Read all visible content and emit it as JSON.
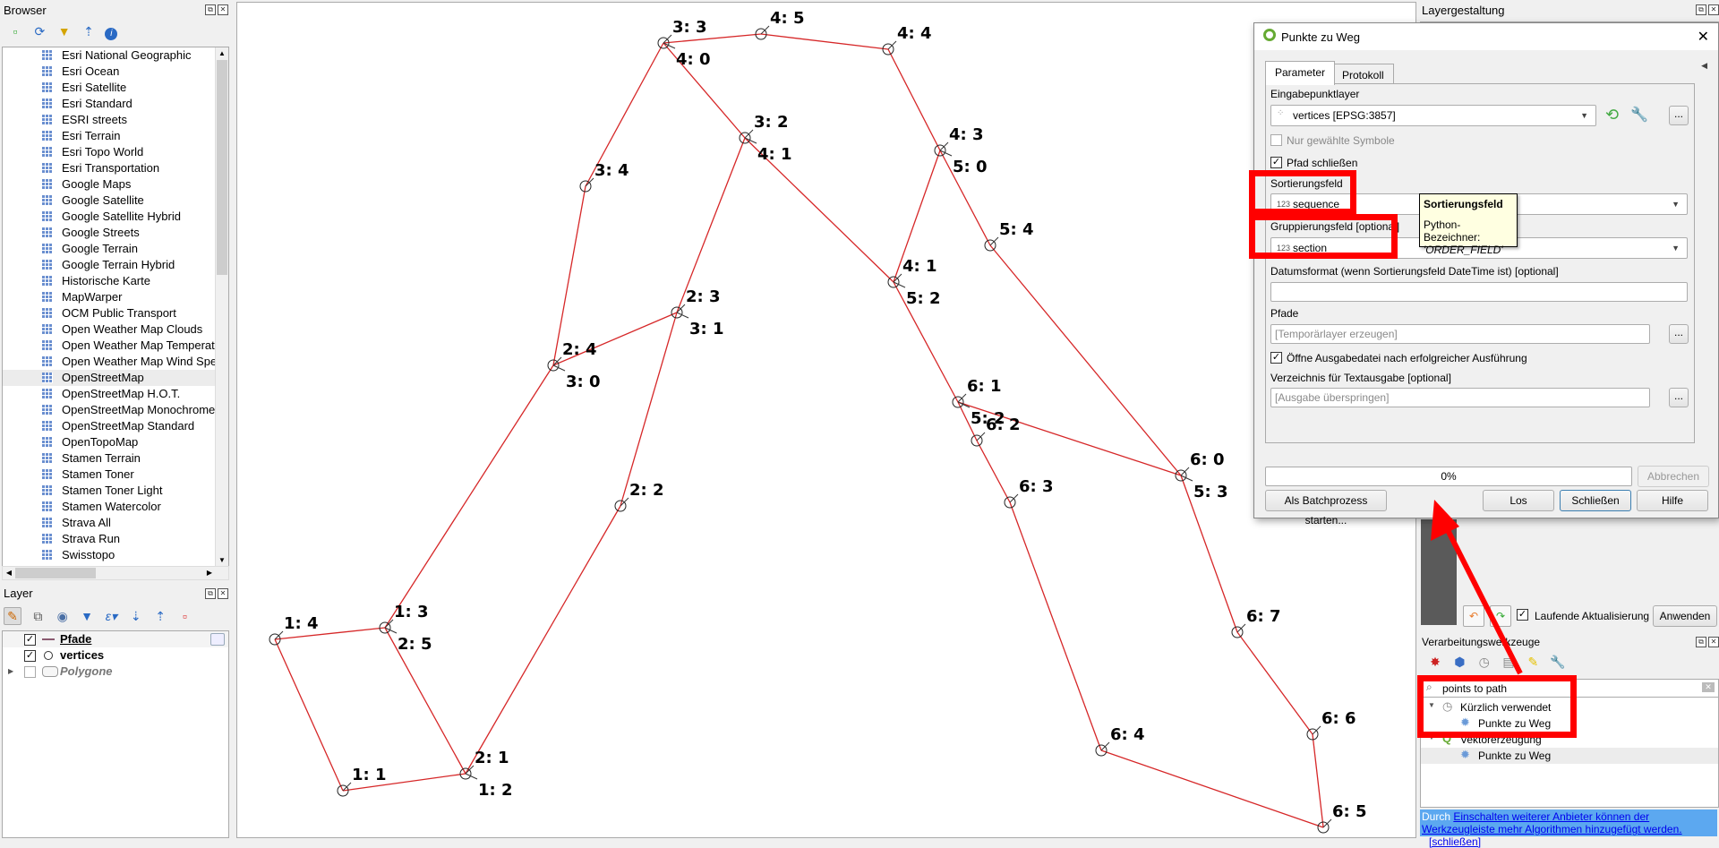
{
  "browser": {
    "title": "Browser",
    "toolbar_icons": [
      "add-layer-icon",
      "refresh-icon",
      "filter-icon",
      "collapse-all-icon",
      "info-icon"
    ],
    "items": [
      {
        "label": "Esri National Geographic"
      },
      {
        "label": "Esri Ocean"
      },
      {
        "label": "Esri Satellite"
      },
      {
        "label": "Esri Standard"
      },
      {
        "label": "ESRI streets"
      },
      {
        "label": "Esri Terrain"
      },
      {
        "label": "Esri Topo World"
      },
      {
        "label": "Esri Transportation"
      },
      {
        "label": "Google Maps"
      },
      {
        "label": "Google Satellite"
      },
      {
        "label": "Google Satellite Hybrid"
      },
      {
        "label": "Google Streets"
      },
      {
        "label": "Google Terrain"
      },
      {
        "label": "Google Terrain Hybrid"
      },
      {
        "label": "Historische Karte"
      },
      {
        "label": "MapWarper"
      },
      {
        "label": "OCM Public Transport"
      },
      {
        "label": "Open Weather Map Clouds"
      },
      {
        "label": "Open Weather Map Temperature"
      },
      {
        "label": "Open Weather Map Wind Speed"
      },
      {
        "label": "OpenStreetMap",
        "selected": true
      },
      {
        "label": "OpenStreetMap H.O.T."
      },
      {
        "label": "OpenStreetMap Monochrome"
      },
      {
        "label": "OpenStreetMap Standard"
      },
      {
        "label": "OpenTopoMap"
      },
      {
        "label": "Stamen Terrain"
      },
      {
        "label": "Stamen Toner"
      },
      {
        "label": "Stamen Toner Light"
      },
      {
        "label": "Stamen Watercolor"
      },
      {
        "label": "Strava All"
      },
      {
        "label": "Strava Run"
      },
      {
        "label": "Swisstopo"
      }
    ]
  },
  "layers": {
    "title": "Layer",
    "items": [
      {
        "label": "Pfade",
        "checked": true,
        "type": "line"
      },
      {
        "label": "vertices",
        "checked": true,
        "type": "point"
      },
      {
        "label": "Polygone",
        "checked": false,
        "type": "polygon"
      }
    ]
  },
  "map": {
    "line_color": "#d62728",
    "vertices": [
      {
        "labels": [
          "1: 4"
        ]
      },
      {
        "labels": [
          "1: 3",
          "2: 5"
        ]
      },
      {
        "labels": [
          "1: 1"
        ]
      },
      {
        "labels": [
          "2: 1",
          "1: 2"
        ]
      },
      {
        "labels": [
          "2: 2"
        ]
      },
      {
        "labels": [
          "2: 3",
          "3: 1"
        ]
      },
      {
        "labels": [
          "2: 4",
          "3: 0"
        ]
      },
      {
        "labels": [
          "3: 4"
        ]
      },
      {
        "labels": [
          "3: 3",
          "4: 0"
        ]
      },
      {
        "labels": [
          "3: 2",
          "4: 1"
        ]
      },
      {
        "labels": [
          "4: 5"
        ]
      },
      {
        "labels": [
          "4: 4"
        ]
      },
      {
        "labels": [
          "4: 3",
          "5: 0"
        ]
      },
      {
        "labels": [
          "4: 1",
          "5: 2"
        ]
      },
      {
        "labels": [
          "5: 4"
        ]
      },
      {
        "labels": [
          "6: 1",
          "5: 2"
        ]
      },
      {
        "labels": [
          "6: 2"
        ]
      },
      {
        "labels": [
          "6: 0",
          "5: 3"
        ]
      },
      {
        "labels": [
          "6: 3"
        ]
      },
      {
        "labels": [
          "6: 4"
        ]
      },
      {
        "labels": [
          "6: 7"
        ]
      },
      {
        "labels": [
          "6: 6"
        ]
      },
      {
        "labels": [
          "6: 5"
        ]
      }
    ]
  },
  "layer_styling": {
    "title": "Layergestaltung",
    "live_update_label": "Laufende Aktualisierung",
    "live_update_checked": true,
    "apply_label": "Anwenden"
  },
  "processing": {
    "title": "Verarbeitungswerkzeuge",
    "search_value": "points to path",
    "groups": [
      {
        "label": "Kürzlich verwendet",
        "items": [
          "Punkte zu Weg"
        ]
      },
      {
        "label": "Vektorerzeugung",
        "items": [
          "Punkte zu Weg"
        ]
      }
    ],
    "info_prefix": "Durch ",
    "info_link": "Einschalten weiterer Anbieter können der Werkzeugleiste mehr Algorithmen hinzugefügt werden.",
    "info_close": "[schließen]"
  },
  "dialog": {
    "title": "Punkte zu Weg",
    "tabs": [
      "Parameter",
      "Protokoll"
    ],
    "input_layer_label": "Eingabepunktlayer",
    "input_layer_value": "vertices [EPSG:3857]",
    "selected_only_label": "Nur gewählte Symbole",
    "selected_only_checked": false,
    "close_path_label": "Pfad schließen",
    "close_path_checked": true,
    "order_field_label": "Sortierungsfeld",
    "order_field_value": "sequence",
    "group_field_label": "Gruppierungsfeld [optional]",
    "group_field_value": "section",
    "field_type_badge": "123",
    "date_format_label": "Datumsformat (wenn Sortierungsfeld DateTime ist) [optional]",
    "date_format_value": "",
    "paths_label": "Pfade",
    "paths_placeholder": "[Temporärlayer erzeugen]",
    "open_output_label": "Öffne Ausgabedatei nach erfolgreicher Ausführung",
    "open_output_checked": true,
    "text_dir_label": "Verzeichnis für Textausgabe [optional]",
    "text_dir_placeholder": "[Ausgabe überspringen]",
    "progress_percent": 0,
    "progress_text": "0%",
    "cancel_label": "Abbrechen",
    "batch_label": "Als Batchprozess starten...",
    "run_label": "Los",
    "close_label": "Schließen",
    "help_label": "Hilfe",
    "more_label": "...",
    "tooltip": {
      "title": "Sortierungsfeld",
      "line1": "Python-Bezeichner:",
      "line2": "'ORDER_FIELD'"
    }
  },
  "annotation": {
    "highlight_color": "#ff0000"
  }
}
